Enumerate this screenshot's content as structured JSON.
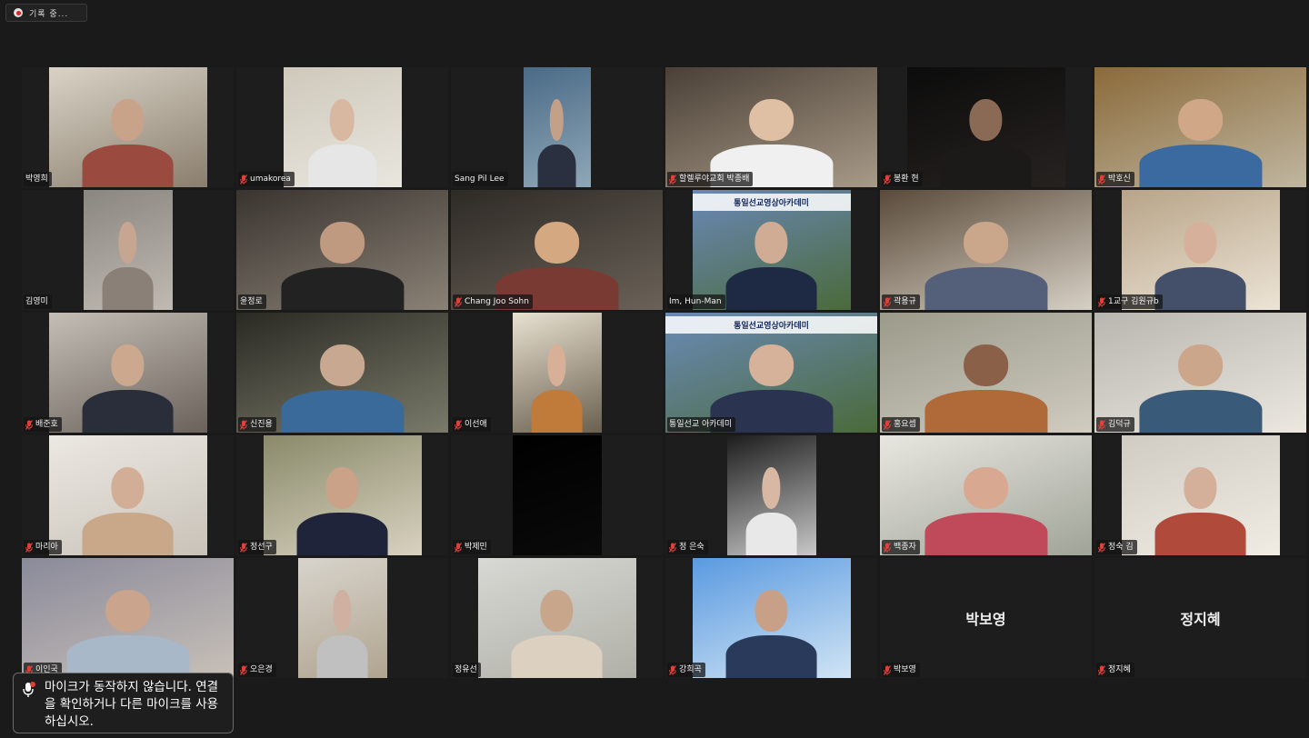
{
  "recording": {
    "label": "기록 중..."
  },
  "notification": {
    "message": "마이크가 동작하지 않습니다. 연결을 확인하거나 다른 마이크를 사용하십시오.",
    "icon": "microphone-warning-icon"
  },
  "colors": {
    "active_speaker_border": "#c8e63a",
    "muted_icon": "#e0403a",
    "background": "#1a1a1a"
  },
  "participants": [
    {
      "name": "박영희",
      "muted": false,
      "video": true
    },
    {
      "name": "umakorea",
      "muted": true,
      "video": true
    },
    {
      "name": "Sang Pil Lee",
      "muted": false,
      "video": true
    },
    {
      "name": "할렐루야교회 박종배",
      "muted": true,
      "video": true
    },
    {
      "name": "봉환 현",
      "muted": true,
      "video": true
    },
    {
      "name": "박호신",
      "muted": true,
      "video": true
    },
    {
      "name": "김영미",
      "muted": false,
      "video": true
    },
    {
      "name": "윤정로",
      "muted": false,
      "video": true
    },
    {
      "name": "Chang Joo Sohn",
      "muted": true,
      "video": true
    },
    {
      "name": "Im, Hun-Man",
      "muted": false,
      "video": true,
      "banner": "통일선교영상아카데미"
    },
    {
      "name": "곽용규",
      "muted": true,
      "video": true
    },
    {
      "name": "1교구 김원규b",
      "muted": true,
      "video": true
    },
    {
      "name": "배준호",
      "muted": true,
      "video": true
    },
    {
      "name": "신진용",
      "muted": true,
      "video": true
    },
    {
      "name": "이선애",
      "muted": true,
      "video": true
    },
    {
      "name": "통일선교 아카데미",
      "muted": false,
      "video": true,
      "banner": "통일선교영상아카데미"
    },
    {
      "name": "홍요셉",
      "muted": true,
      "video": true
    },
    {
      "name": "김덕규",
      "muted": true,
      "video": true,
      "active": true
    },
    {
      "name": "마리아",
      "muted": true,
      "video": true
    },
    {
      "name": "정선구",
      "muted": true,
      "video": true
    },
    {
      "name": "박제민",
      "muted": true,
      "video": true
    },
    {
      "name": "정 은숙",
      "muted": true,
      "video": true
    },
    {
      "name": "백종자",
      "muted": true,
      "video": true
    },
    {
      "name": "정숙 김",
      "muted": true,
      "video": true
    },
    {
      "name": "이인국",
      "muted": true,
      "video": true
    },
    {
      "name": "오은경",
      "muted": true,
      "video": true
    },
    {
      "name": "정유선",
      "muted": false,
      "video": true
    },
    {
      "name": "강희곡",
      "muted": true,
      "video": true
    },
    {
      "name": "박보영",
      "muted": true,
      "video": false
    },
    {
      "name": "정지혜",
      "muted": true,
      "video": false
    }
  ]
}
